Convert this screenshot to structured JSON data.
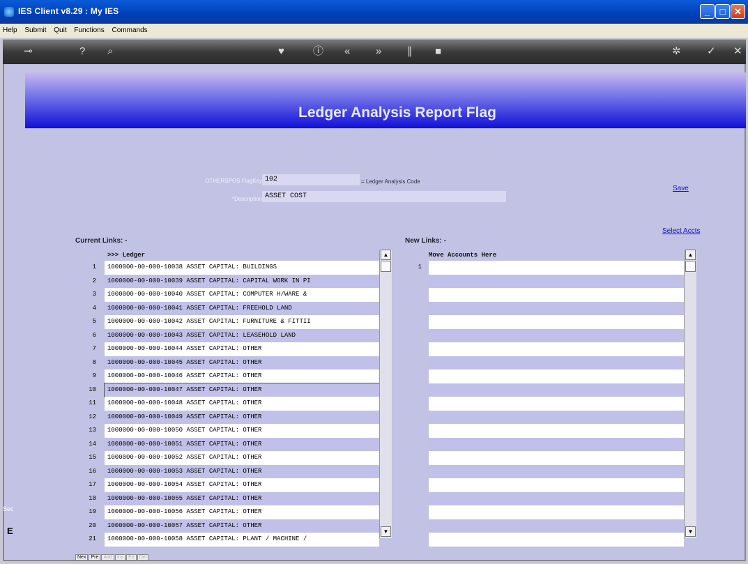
{
  "window": {
    "title": "IES Client v8.29 : My IES"
  },
  "menu": [
    "Help",
    "Submit",
    "Quit",
    "Functions",
    "Commands"
  ],
  "toolbar": [
    {
      "name": "key-icon",
      "glyph": "⊸"
    },
    {
      "name": "help-icon",
      "glyph": "?"
    },
    {
      "name": "search-icon",
      "glyph": "⌕"
    },
    {
      "name": "heart-icon",
      "glyph": "♥"
    },
    {
      "name": "info-icon",
      "glyph": "ⓘ"
    },
    {
      "name": "rewind-icon",
      "glyph": "«"
    },
    {
      "name": "forward-icon",
      "glyph": "»"
    },
    {
      "name": "stop-icon",
      "glyph": "∥"
    },
    {
      "name": "square-icon",
      "glyph": "■"
    },
    {
      "name": "settings-icon",
      "glyph": "✲"
    },
    {
      "name": "check-icon",
      "glyph": "✓"
    },
    {
      "name": "close-icon",
      "glyph": "✕"
    }
  ],
  "page": {
    "title": "Ledger Analysis Report Flag"
  },
  "form": {
    "flagkey_label": "OTHERSPOS FlagKey",
    "flagkey_value": "102",
    "flagkey_hint": "= Ledger Analysis Code",
    "description_label": "*Description",
    "description_value": "ASSET COST",
    "save_link": "Save",
    "select_link": "Select Accts"
  },
  "current": {
    "heading": "Current Links: -",
    "header": ">>> Ledger",
    "rows": [
      {
        "n": "1",
        "text": "1000000-00-000-10038 ASSET CAPITAL: BUILDINGS"
      },
      {
        "n": "2",
        "text": "1000000-00-000-10039 ASSET CAPITAL: CAPITAL WORK IN PI"
      },
      {
        "n": "3",
        "text": "1000000-00-000-10040 ASSET CAPITAL: COMPUTER H/WARE &"
      },
      {
        "n": "4",
        "text": "1000000-00-000-10041 ASSET CAPITAL: FREEHOLD LAND"
      },
      {
        "n": "5",
        "text": "1000000-00-000-10042 ASSET CAPITAL: FURNITURE & FITTII"
      },
      {
        "n": "6",
        "text": "1000000-00-000-10043 ASSET CAPITAL: LEASEHOLD LAND"
      },
      {
        "n": "7",
        "text": "1000000-00-000-10044 ASSET CAPITAL: OTHER"
      },
      {
        "n": "8",
        "text": "1000000-00-000-10045 ASSET CAPITAL: OTHER"
      },
      {
        "n": "9",
        "text": "1000000-00-000-10046 ASSET CAPITAL: OTHER"
      },
      {
        "n": "10",
        "text": "1000000-00-000-10047 ASSET CAPITAL: OTHER"
      },
      {
        "n": "11",
        "text": "1000000-00-000-10048 ASSET CAPITAL: OTHER"
      },
      {
        "n": "12",
        "text": "1000000-00-000-10049 ASSET CAPITAL: OTHER"
      },
      {
        "n": "13",
        "text": "1000000-00-000-10050 ASSET CAPITAL: OTHER"
      },
      {
        "n": "14",
        "text": "1000000-00-000-10051 ASSET CAPITAL: OTHER"
      },
      {
        "n": "15",
        "text": "1000000-00-000-10052 ASSET CAPITAL: OTHER"
      },
      {
        "n": "16",
        "text": "1000000-00-000-10053 ASSET CAPITAL: OTHER"
      },
      {
        "n": "17",
        "text": "1000000-00-000-10054 ASSET CAPITAL: OTHER"
      },
      {
        "n": "18",
        "text": "1000000-00-000-10055 ASSET CAPITAL: OTHER"
      },
      {
        "n": "19",
        "text": "1000000-00-000-10056 ASSET CAPITAL: OTHER"
      },
      {
        "n": "20",
        "text": "1000000-00-000-10057 ASSET CAPITAL: OTHER"
      },
      {
        "n": "21",
        "text": "1000000-00-000-10058 ASSET CAPITAL: PLANT / MACHINE /"
      }
    ],
    "selected_row": "10"
  },
  "newlinks": {
    "heading": "New Links: -",
    "header": "Move Accounts Here",
    "first_row_num": "1"
  },
  "buttons": [
    "Nex",
    "Pre",
    "Add",
    "Ins",
    "Ed",
    "Del"
  ],
  "side": {
    "top": "Sec",
    "bottom": "E"
  }
}
